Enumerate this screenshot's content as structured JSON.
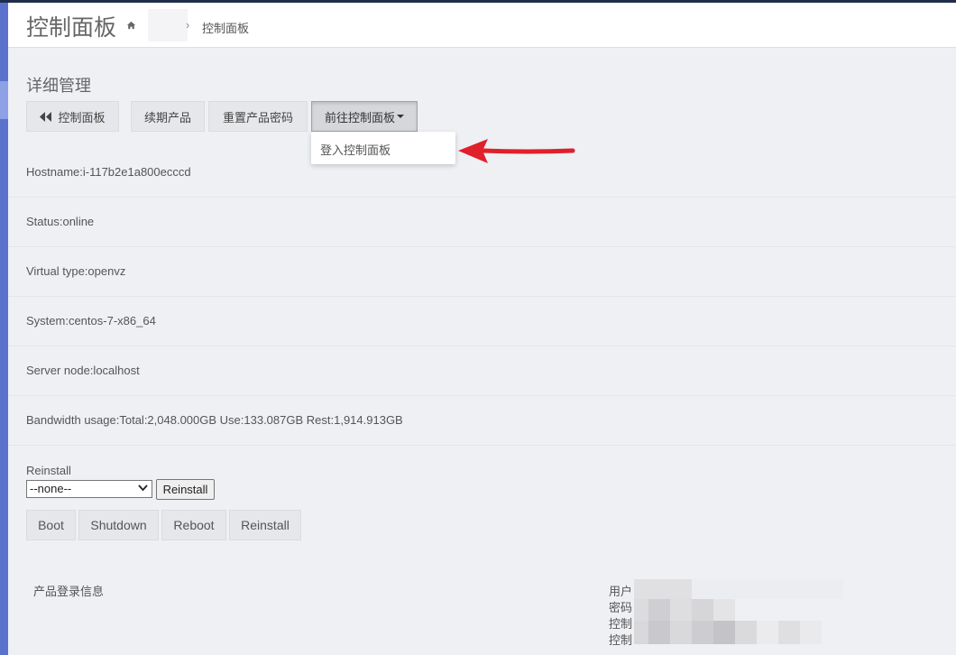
{
  "header": {
    "title": "控制面板",
    "breadcrumb_sep": "›",
    "breadcrumb_current": "控制面板"
  },
  "section": {
    "title": "详细管理"
  },
  "toolbar": {
    "back_label": "控制面板",
    "renew_label": "续期产品",
    "reset_password_label": "重置产品密码",
    "goto_panel_label": "前往控制面板"
  },
  "dropdown": {
    "login_panel_label": "登入控制面板"
  },
  "info": {
    "hostname": "Hostname:i-117b2e1a800ecccd",
    "status": "Status:online",
    "virtual_type": "Virtual type:openvz",
    "system": "System:centos-7-x86_64",
    "server_node": "Server node:localhost",
    "bandwidth": "Bandwidth usage:Total:2,048.000GB Use:133.087GB Rest:1,914.913GB"
  },
  "reinstall": {
    "label": "Reinstall",
    "select_value": "--none--",
    "button_label": "Reinstall"
  },
  "power": {
    "boot": "Boot",
    "shutdown": "Shutdown",
    "reboot": "Reboot",
    "reinstall": "Reinstall"
  },
  "login_info": {
    "title": "产品登录信息",
    "user_label": "用户",
    "password_label": "密码",
    "panel_label_1": "控制",
    "panel_label_2": "控制"
  },
  "colors": {
    "sidebar": "#5a72cc",
    "annotation_arrow": "#e0202a",
    "background": "#eef0f4"
  }
}
